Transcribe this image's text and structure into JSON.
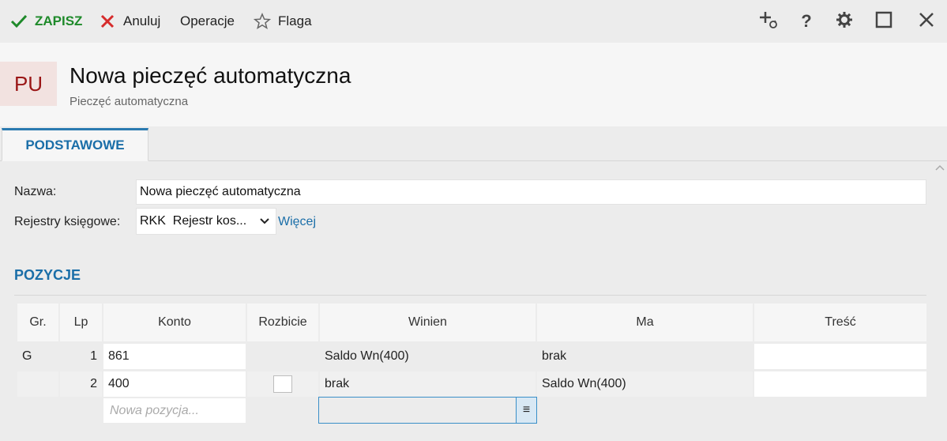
{
  "toolbar": {
    "save_label": "ZAPISZ",
    "cancel_label": "Anuluj",
    "operations_label": "Operacje",
    "flag_label": "Flaga"
  },
  "header": {
    "badge": "PU",
    "title": "Nowa pieczęć automatyczna",
    "subtitle": "Pieczęć automatyczna"
  },
  "tabs": [
    {
      "label": "PODSTAWOWE"
    }
  ],
  "form": {
    "name_label": "Nazwa:",
    "name_value": "Nowa pieczęć automatyczna",
    "registers_label": "Rejestry księgowe:",
    "registers_value": "RKK  Rejestr kos...",
    "more_link": "Więcej"
  },
  "positions": {
    "section_title": "POZYCJE",
    "columns": [
      "Gr.",
      "Lp",
      "Konto",
      "Rozbicie",
      "Winien",
      "Ma",
      "Treść"
    ],
    "rows": [
      {
        "gr": "G",
        "lp": "1",
        "konto": "861",
        "rozbicie": false,
        "winien": "Saldo Wn(400)",
        "ma": "brak",
        "tresc": ""
      },
      {
        "gr": "",
        "lp": "2",
        "konto": "400",
        "rozbicie": false,
        "winien": "brak",
        "ma": "Saldo Wn(400)",
        "tresc": ""
      }
    ],
    "new_row_placeholder": "Nowa pozycja...",
    "dropdown_button_icon": "≡"
  },
  "colors": {
    "accent": "#1a6ea8",
    "save_green": "#1e8a2a",
    "cancel_red": "#d62b2b",
    "badge_text": "#9a1616",
    "badge_bg": "#f2e2e0"
  }
}
